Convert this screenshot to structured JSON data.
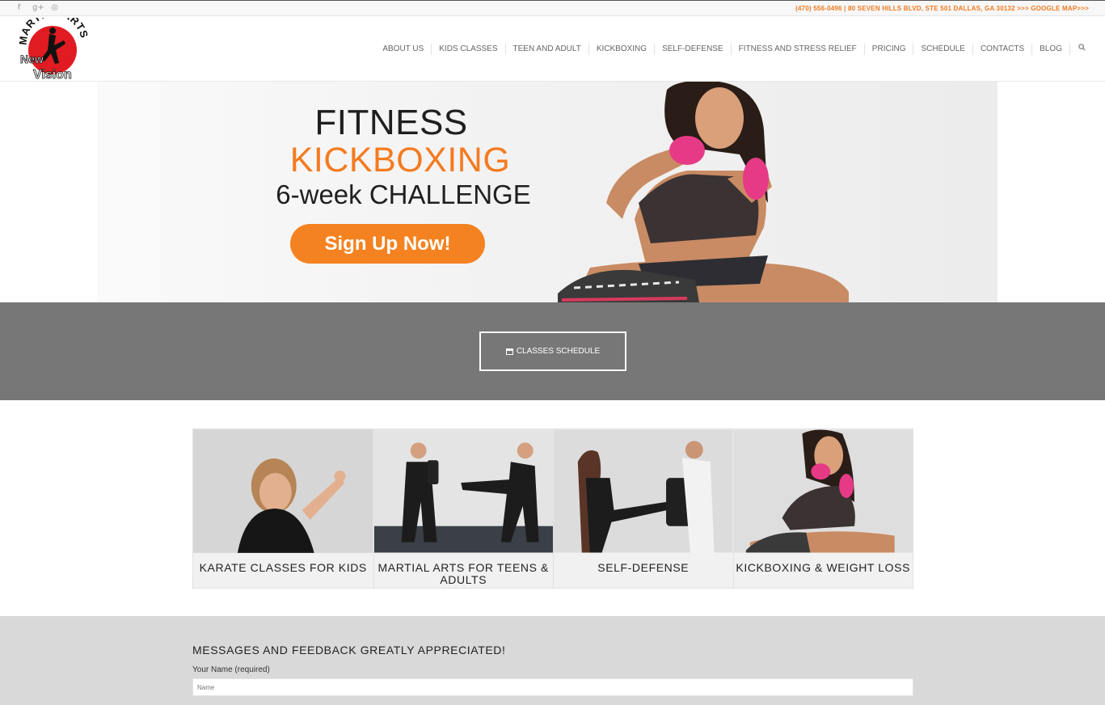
{
  "topbar": {
    "social_icons": [
      "facebook-icon",
      "google-plus-icon",
      "instagram-icon"
    ],
    "social_glyphs": [
      "f",
      "g+",
      "◎"
    ],
    "contact_line": "(470) 556-0496 | 80 SEVEN HILLS BLVD, STE 501 DALLAS, GA 30132 >>> GOOGLE MAP>>>"
  },
  "header": {
    "logo": {
      "arc_text": "MARTIAL ARTS",
      "word1": "New",
      "word2": "Vision"
    },
    "nav": [
      "ABOUT US",
      "KIDS CLASSES",
      "TEEN AND ADULT",
      "KICKBOXING",
      "SELF-DEFENSE",
      "FITNESS AND STRESS RELIEF",
      "PRICING",
      "SCHEDULE",
      "CONTACTS",
      "BLOG"
    ],
    "search_icon": "search-icon"
  },
  "hero": {
    "line1": "FITNESS",
    "line2": "KICKBOXING",
    "line3": "6-week CHALLENGE",
    "cta": "Sign Up Now!"
  },
  "schedule_band": {
    "button_label": "CLASSES SCHEDULE",
    "icon": "calendar-icon"
  },
  "cards": [
    {
      "title": "KARATE CLASSES FOR KIDS"
    },
    {
      "title": "MARTIAL ARTS FOR TEENS & ADULTS"
    },
    {
      "title": "SELF-DEFENSE"
    },
    {
      "title": "KICKBOXING & WEIGHT LOSS"
    }
  ],
  "form": {
    "title": "MESSAGES AND FEEDBACK GREATLY APPRECIATED!",
    "name_label": "Your Name (required)",
    "name_placeholder": "Name"
  },
  "colors": {
    "accent_orange": "#f47b20",
    "band_gray": "#777777",
    "form_bg": "#d9d9d9"
  }
}
